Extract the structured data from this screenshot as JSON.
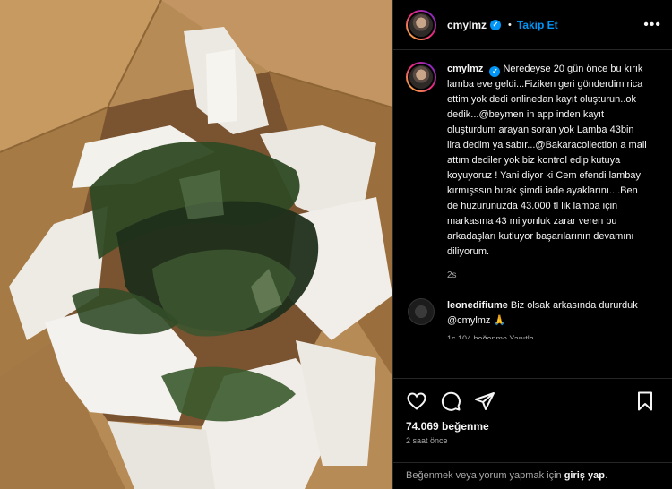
{
  "colors": {
    "accent": "#0095f6",
    "background": "#000000",
    "text": "#f5f5f5",
    "muted": "#a8a8a8"
  },
  "header": {
    "username": "cmylmz",
    "separator": "•",
    "follow_label": "Takip Et",
    "more_label": "•••"
  },
  "caption": {
    "username": "cmylmz",
    "text": "Neredeyse 20 gün önce bu kırık lamba eve geldi...Fiziken geri gönderdim rica ettim yok dedi onlinedan kayıt oluşturun..ok dedik...@beymen in app inden kayıt oluşturdum arayan soran yok Lamba 43bin lira dedim ya sabır...@Bakaracollection a mail attım dediler yok biz kontrol edip kutuya koyuyoruz ! Yani diyor ki Cem efendi lambayı kırmışssın bırak şimdi iade ayaklarını....Ben de huzurunuzda 43.000 tl lik lamba için markasına 43 milyonluk zarar veren bu arkadaşları kutluyor başarılarının devamını diliyorum.",
    "time": "2s"
  },
  "comment": {
    "username": "leonedifiume",
    "text": "Biz olsak arkasında dururduk @cmylmz 🙏",
    "meta": "1s   104 beğenme   Yanıtla"
  },
  "actions": {
    "likes": "74.069 beğenme",
    "posted_ago": "2 saat önce",
    "icons": [
      "heart-icon",
      "comment-icon",
      "share-icon",
      "bookmark-icon"
    ]
  },
  "login_bar": {
    "prefix": "Beğenmek veya yorum yapmak için",
    "link": "giriş yap",
    "suffix": "."
  }
}
